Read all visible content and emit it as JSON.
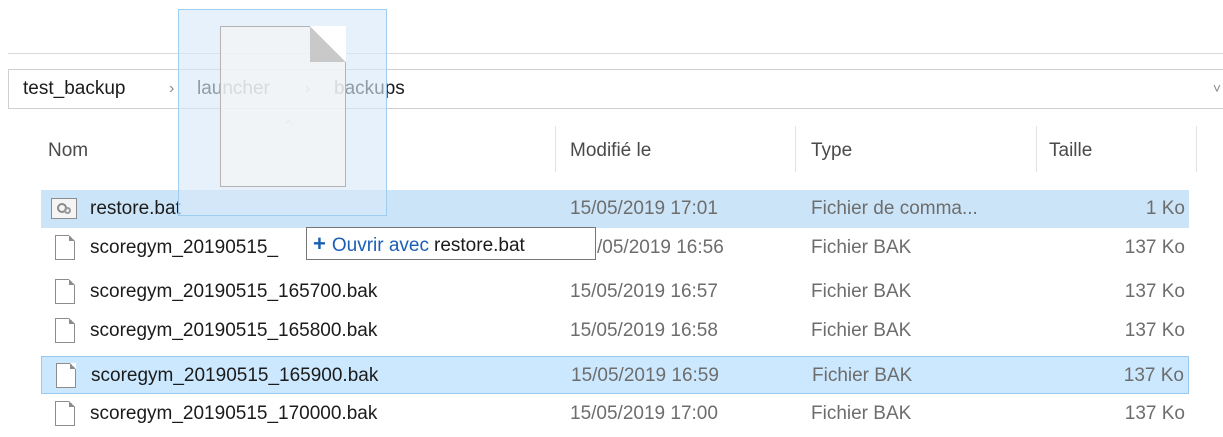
{
  "breadcrumb": {
    "items": [
      "test_backup",
      "launcher",
      "backups"
    ],
    "separator": "›"
  },
  "columns": {
    "name": "Nom",
    "modified": "Modifié le",
    "type": "Type",
    "size": "Taille"
  },
  "files": [
    {
      "name": "restore.bat",
      "modified": "15/05/2019 17:01",
      "type": "Fichier de comma...",
      "size": "1 Ko",
      "icon": "batch-file-icon",
      "state": "selected"
    },
    {
      "name": "scoregym_20190515_",
      "modified": "/05/2019 16:56",
      "type": "Fichier BAK",
      "size": "137 Ko",
      "icon": "file-icon",
      "state": "normal"
    },
    {
      "name": "scoregym_20190515_165700.bak",
      "modified": "15/05/2019 16:57",
      "type": "Fichier BAK",
      "size": "137 Ko",
      "icon": "file-icon",
      "state": "normal"
    },
    {
      "name": "scoregym_20190515_165800.bak",
      "modified": "15/05/2019 16:58",
      "type": "Fichier BAK",
      "size": "137 Ko",
      "icon": "file-icon",
      "state": "normal"
    },
    {
      "name": "scoregym_20190515_165900.bak",
      "modified": "15/05/2019 16:59",
      "type": "Fichier BAK",
      "size": "137 Ko",
      "icon": "file-icon",
      "state": "focused"
    },
    {
      "name": "scoregym_20190515_170000.bak",
      "modified": "15/05/2019 17:00",
      "type": "Fichier BAK",
      "size": "137 Ko",
      "icon": "file-icon",
      "state": "normal"
    }
  ],
  "drop_tooltip": {
    "plus": "+",
    "verb": "Ouvrir avec",
    "target": "restore.bat"
  },
  "colors": {
    "selection": "#cce4f7",
    "focus_border": "#99c9ef",
    "tooltip_accent": "#1a5fb4"
  }
}
